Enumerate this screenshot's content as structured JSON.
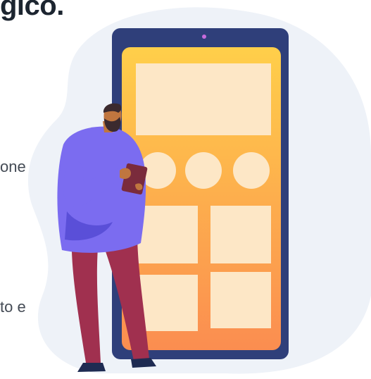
{
  "heading": "gico.",
  "text_fragments": [
    "one",
    "to e"
  ],
  "illustration": {
    "colors": {
      "blob": "#eef2f8",
      "phone_frame": "#2f3f7a",
      "screen_top": "#ffcf4a",
      "screen_bottom": "#fb8d50",
      "tile": "#fde7c6",
      "camera": "#c86bdc",
      "shirt": "#7b6cf0",
      "shirt_shadow": "#5a4fd8",
      "pants": "#a0304f",
      "skin": "#c0763f",
      "hair": "#3b2a2e",
      "shoes": "#1e2b52",
      "tablet": "#7a2b3c"
    }
  }
}
